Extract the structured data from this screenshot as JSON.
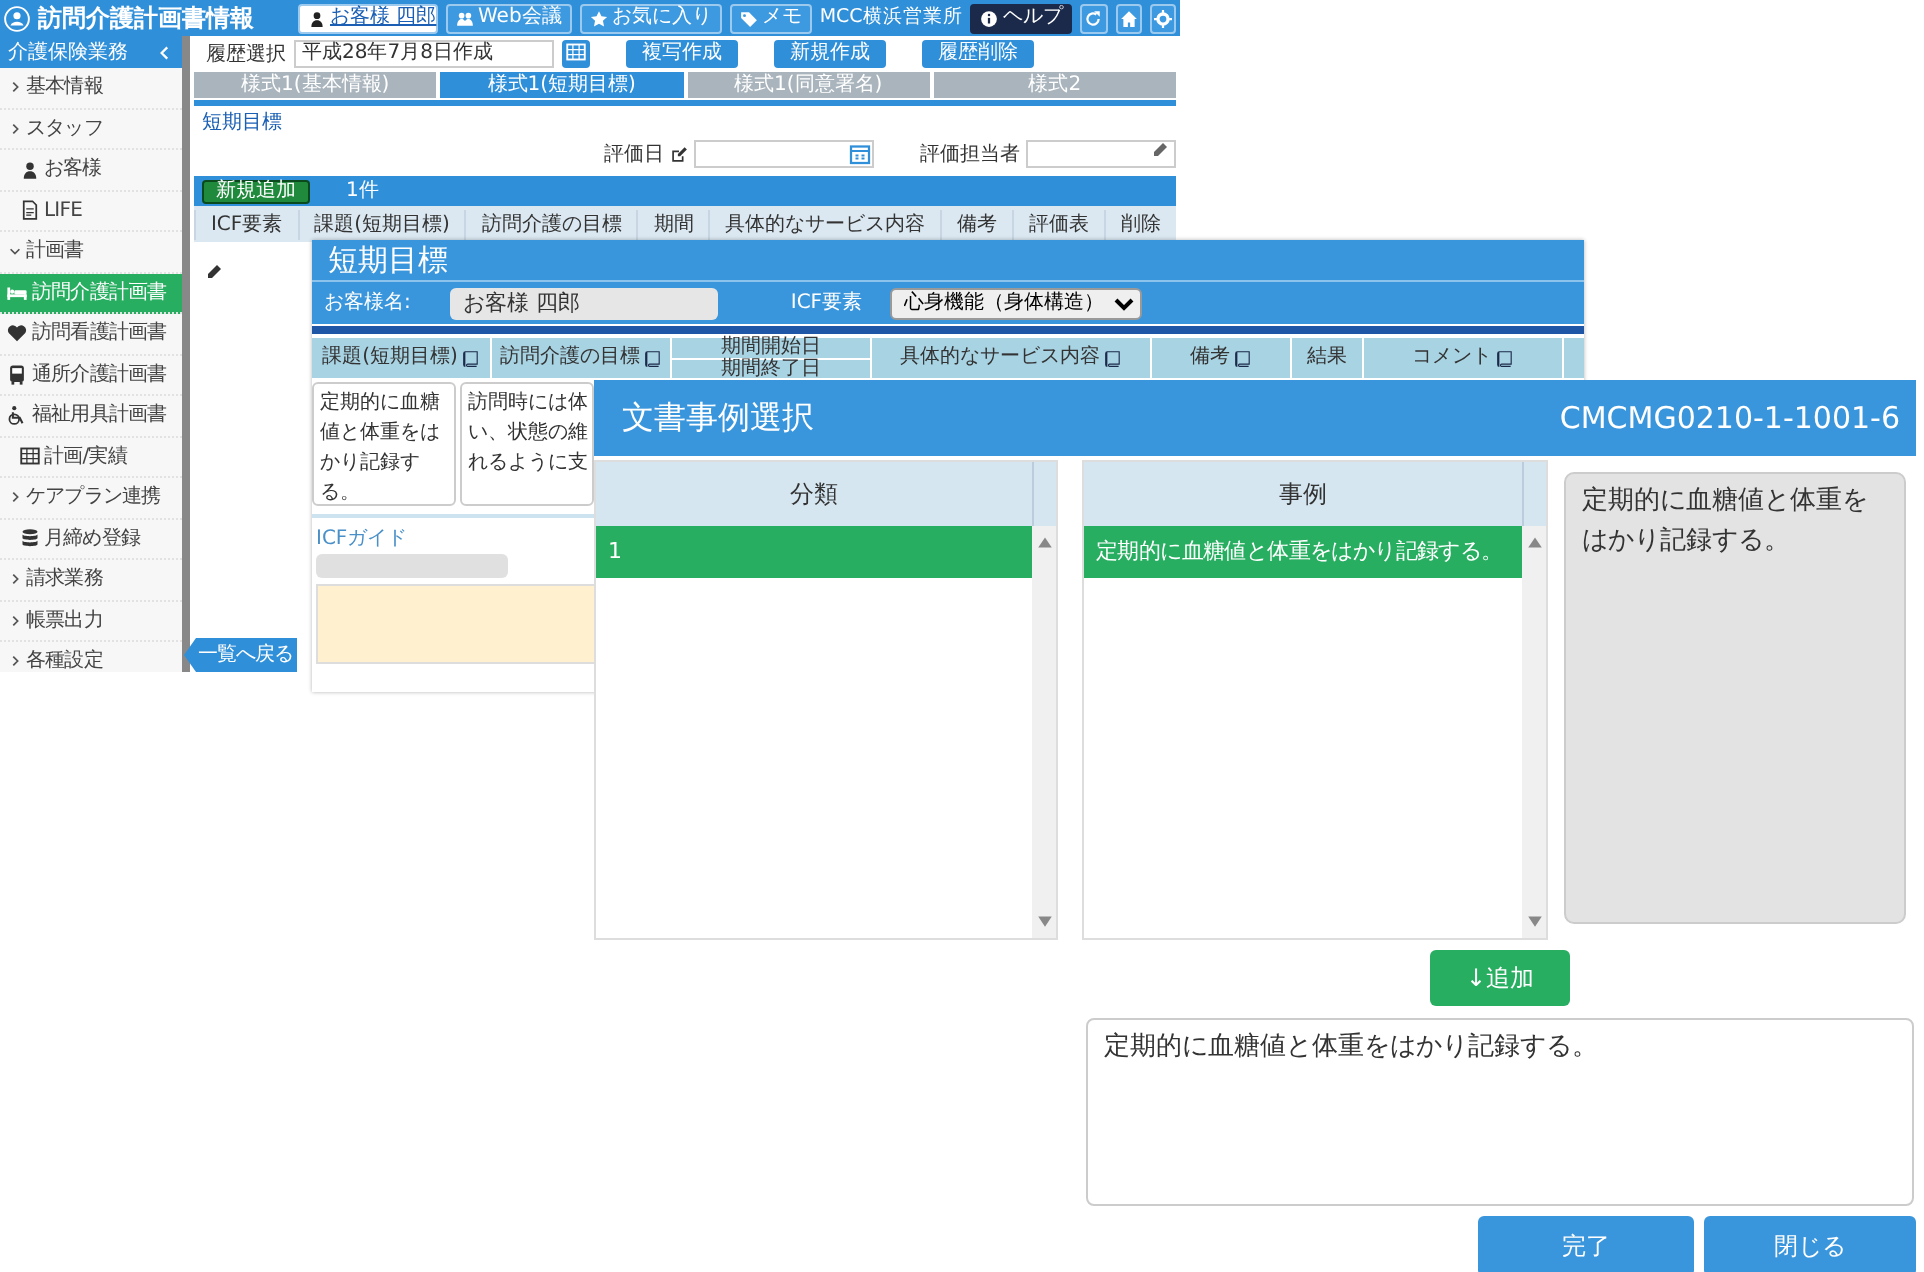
{
  "app": {
    "title": "訪問介護計画書情報",
    "customer": "お客様 四郎",
    "toolbar_buttons": [
      "Web会議",
      "お気に入り",
      "メモ"
    ],
    "office": "MCC横浜営業所",
    "help": "ヘルプ"
  },
  "sidebar": {
    "title": "介護保険業務",
    "items": [
      {
        "label": "基本情報",
        "kind": "group",
        "expanded": false
      },
      {
        "label": "スタッフ",
        "kind": "group",
        "expanded": false
      },
      {
        "label": "お客様",
        "kind": "link",
        "selected": false
      },
      {
        "label": "LIFE",
        "kind": "link",
        "selected": false
      },
      {
        "label": "計画書",
        "kind": "group",
        "expanded": true,
        "children": [
          {
            "label": "訪問介護計画書",
            "selected": true
          },
          {
            "label": "訪問看護計画書",
            "selected": false
          },
          {
            "label": "通所介護計画書",
            "selected": false
          },
          {
            "label": "福祉用具計画書",
            "selected": false
          }
        ]
      },
      {
        "label": "計画/実績",
        "kind": "link",
        "selected": false
      },
      {
        "label": "ケアプラン連携",
        "kind": "group",
        "expanded": false
      },
      {
        "label": "月締め登録",
        "kind": "link",
        "selected": false
      },
      {
        "label": "請求業務",
        "kind": "group",
        "expanded": false
      },
      {
        "label": "帳票出力",
        "kind": "group",
        "expanded": false
      },
      {
        "label": "各種設定",
        "kind": "group",
        "expanded": false
      }
    ]
  },
  "main": {
    "history_label": "履歴選択",
    "history_value": "平成28年7月8日作成",
    "actions": [
      "複写作成",
      "新規作成",
      "履歴削除"
    ],
    "tabs": [
      {
        "label": "様式1(基本情報)",
        "selected": false
      },
      {
        "label": "様式1(短期目標)",
        "selected": true
      },
      {
        "label": "様式1(同意署名)",
        "selected": false
      },
      {
        "label": "様式2",
        "selected": false
      }
    ],
    "section": "短期目標",
    "eval_date_label": "評価日",
    "evaluator_label": "評価担当者",
    "add_button": "新規追加",
    "count": "1件",
    "columns": [
      "ICF要素",
      "課題(短期目標)",
      "訪問介護の目標",
      "期間",
      "具体的なサービス内容",
      "備考",
      "評価表",
      "削除"
    ],
    "back_button": "一覧へ戻る"
  },
  "goal_dialog": {
    "title": "短期目標",
    "customer_label": "お客様名:",
    "customer": "お客様 四郎",
    "icf_label": "ICF要素",
    "icf_value": "心身機能（身体構造）",
    "columns": [
      {
        "labels": [
          "課題(短期目標)"
        ],
        "has_icon": true
      },
      {
        "labels": [
          "訪問介護の目標"
        ],
        "has_icon": true
      },
      {
        "labels": [
          "期間開始日",
          "期間終了日"
        ],
        "has_icon": false
      },
      {
        "labels": [
          "具体的なサービス内容"
        ],
        "has_icon": true
      },
      {
        "labels": [
          "備考"
        ],
        "has_icon": true
      },
      {
        "labels": [
          "結果"
        ],
        "has_icon": false
      },
      {
        "labels": [
          "コメント"
        ],
        "has_icon": true
      }
    ],
    "texts": [
      {
        "kind": "text",
        "text": "定期的に血糖値と体重をはかり記録する。"
      },
      {
        "kind": "lines",
        "lines": [
          "訪問時には体",
          "い、状態の維",
          "れるように支"
        ]
      }
    ],
    "icf_guide": "ICFガイド"
  },
  "case_dialog": {
    "title": "文書事例選択",
    "code": "CMCMG0210-1-1001-6",
    "category_header": "分類",
    "categories": [
      {
        "label": "1",
        "selected": true
      }
    ],
    "example_header": "事例",
    "examples": [
      {
        "label": "定期的に血糖値と体重をはかり記録する。",
        "selected": true
      }
    ],
    "preview": "定期的に血糖値と体重をはかり記録する。",
    "add_button": "↓追加",
    "text": "定期的に血糖値と体重をはかり記録する。",
    "buttons": [
      "完了",
      "閉じる"
    ]
  }
}
